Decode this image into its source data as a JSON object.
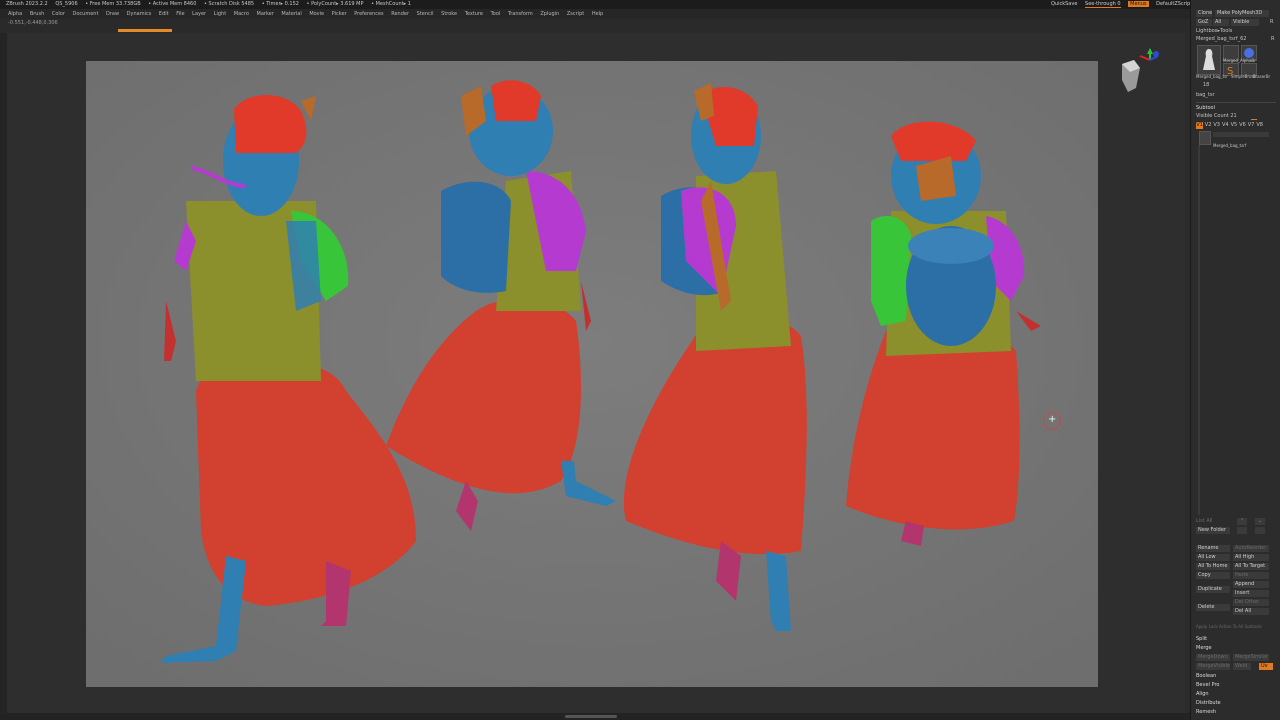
{
  "titlebar": {
    "app": "ZBrush 2023.2.2",
    "file": "QS_5906",
    "free_mem": "• Free Mem 33.738GB",
    "active_mem": "• Active Mem 8460",
    "scratch": "• Scratch Disk 5485",
    "timer": "• Timer▸ 0.152",
    "polycount": "• PolyCount▸ 3.619 MP",
    "meshcount": "• MeshCount▸ 1"
  },
  "top_right": {
    "quicksave": "QuickSave",
    "seethrough": "See-through   0",
    "menus": "Menus",
    "script": "DefaultZScript"
  },
  "menu": [
    "Alpha",
    "Brush",
    "Color",
    "Document",
    "Draw",
    "Dynamics",
    "Edit",
    "File",
    "Layer",
    "Light",
    "Macro",
    "Marker",
    "Material",
    "Movie",
    "Picker",
    "Preferences",
    "Render",
    "Stencil",
    "Stroke",
    "Texture",
    "Tool",
    "Transform",
    "Zplugin",
    "Zscript",
    "Help"
  ],
  "coords": "-0.551,-0.448,0.306",
  "right_panel": {
    "clone": "Clone",
    "make_polymesh": "Make PolyMesh3D",
    "goz": "GoZ",
    "all": "All",
    "visible": "Visible",
    "r": "R",
    "lightbox_tools": "Lightbox▸Tools",
    "tool_name": "Merged_bag_tsrf_62",
    "tool_count": "R",
    "thumb1_label": "Merged_bag_tsr",
    "thumb2_label": "Merged_AlphaBr",
    "thumb3_label": "SimpleBrush",
    "thumb4_label": "EraserBr",
    "thumb_count": "18",
    "current": "bag_tsr",
    "subtool": "Subtool",
    "visible_count": "Visible Count 21",
    "versions": [
      "V1",
      "V2",
      "V3",
      "V4",
      "V5",
      "V6",
      "V7",
      "V8"
    ],
    "subtool_item": "Merged_bag_tsrf",
    "list_all": "List All",
    "new_folder": "New Folder",
    "rename": "Rename",
    "autoreorder": "AutoReorder",
    "all_low": "All Low",
    "all_high": "All High",
    "all_to_home": "All To Home",
    "all_to_target": "All To Target",
    "copy": "Copy",
    "paste": "Paste",
    "duplicate": "Duplicate",
    "append": "Append",
    "insert": "Insert",
    "delete": "Delete",
    "del_other": "Del Other",
    "del_all": "Del All",
    "apply_list": "Apply Lock Action To All Subtools",
    "split": "Split",
    "merge": "Merge",
    "mergedown": "MergeDown",
    "mergesimilar": "MergeSimilar",
    "mergevisible": "MergeVisible",
    "weld": "Weld",
    "uv": "Uv",
    "boolean": "Boolean",
    "bevel_pro": "Bevel Pro",
    "align": "Align",
    "distribute": "Distribute",
    "remesh": "Remesh"
  },
  "colors": {
    "accent": "#e07a1f",
    "skin": "#2f7fb3",
    "hair": "#e23a2a",
    "skirt": "#d2402f",
    "vest": "#8b8f2c",
    "sleeve_green": "#38c53a",
    "sleeve_purple": "#b53bd0",
    "basket": "#2c6fa7",
    "ribbon": "#b86a2a"
  }
}
